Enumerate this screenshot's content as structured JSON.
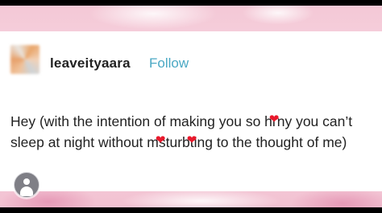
{
  "post": {
    "username": "leaveityaara",
    "follow_label": "Follow",
    "text_segments": [
      "Hey (with the intention of making you so h",
      "rny you can’t sleep at night without m",
      "sturb",
      "ting to the thought of me)"
    ]
  },
  "icons": {
    "heart_emoji": "heart-emoji-icon",
    "user": "user-icon"
  },
  "colors": {
    "follow_link": "#4aa8c4",
    "heart": "#e8192c",
    "background_pink": "#f4c8d6"
  }
}
